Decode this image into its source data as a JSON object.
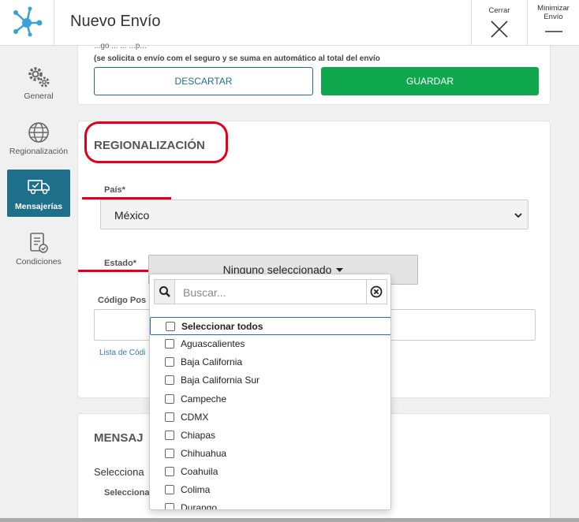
{
  "header": {
    "title": "Nuevo Envío",
    "close_label": "Cerrar",
    "minimize_label": "Minimizar Envío"
  },
  "sidebar": {
    "items": [
      {
        "label": "General",
        "icon": "gears-icon"
      },
      {
        "label": "Regionalización",
        "icon": "globe-icon"
      },
      {
        "label": "Mensajerías",
        "icon": "truck-icon",
        "active": true
      },
      {
        "label": "Condiciones",
        "icon": "document-check-icon"
      }
    ]
  },
  "top_card": {
    "faded_line_1": "...go ... ... ...p...",
    "faded_line_2": "(se solicita o envío com el seguro y se suma en automático al total del envío",
    "discard_label": "DESCARTAR",
    "save_label": "GUARDAR"
  },
  "regionalizacion": {
    "title": "REGIONALIZACIÓN",
    "pais_label": "País*",
    "pais_value": "México",
    "estado_label": "Estado*",
    "estado_button": "Ninguno seleccionado",
    "codigo_label": "Código Pos",
    "help_text": "Lista de Códi"
  },
  "mensajerias": {
    "title": "MENSAJ",
    "select_label": "Selecciona",
    "sub_label": "Selecciona"
  },
  "dropdown": {
    "search_placeholder": "Buscar...",
    "options": [
      "Seleccionar todos",
      "Aguascalientes",
      "Baja California",
      "Baja California Sur",
      "Campeche",
      "CDMX",
      "Chiapas",
      "Chihuahua",
      "Coahuila",
      "Colima",
      "Durango"
    ]
  },
  "colors": {
    "accent": "#1d6f8a",
    "save_green": "#10a84f",
    "highlight_red": "#e0001b"
  }
}
